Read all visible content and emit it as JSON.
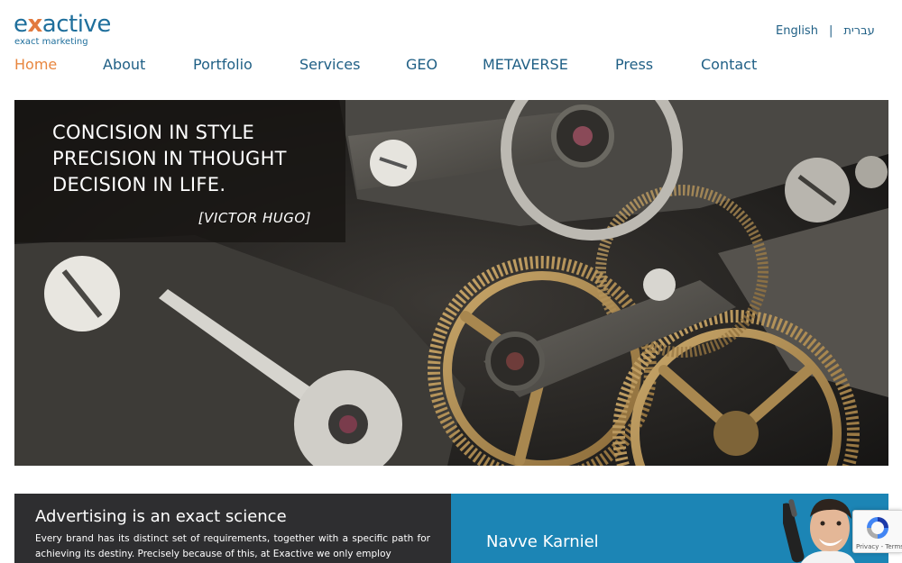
{
  "header": {
    "logo_main_before": "e",
    "logo_main_x": "x",
    "logo_main_after": "active",
    "logo_tagline": "exact marketing"
  },
  "languages": {
    "english": "English",
    "separator": "|",
    "hebrew": "עברית"
  },
  "nav": {
    "items": [
      {
        "label": "Home",
        "active": true
      },
      {
        "label": "About"
      },
      {
        "label": "Portfolio"
      },
      {
        "label": "Services"
      },
      {
        "label": "GEO"
      },
      {
        "label": "METAVERSE"
      },
      {
        "label": "Press"
      },
      {
        "label": "Contact"
      }
    ]
  },
  "hero": {
    "quote_lines": [
      "CONCISION IN STYLE",
      "PRECISION IN THOUGHT",
      "DECISION IN LIFE."
    ],
    "author": "[VICTOR HUGO]"
  },
  "panels": {
    "left_title": "Advertising is an exact science",
    "left_text": "Every brand has its distinct set of requirements, together with a specific path for achieving its destiny. Precisely because of this, at Exactive we only employ",
    "right_name": "Navve Karniel"
  },
  "recaptcha": {
    "text": "Privacy - Terms"
  },
  "colors": {
    "brand_blue": "#1f5f85",
    "accent_orange": "#e8863f",
    "panel_dark": "#2e2e30",
    "panel_blue": "#1c85b5"
  }
}
